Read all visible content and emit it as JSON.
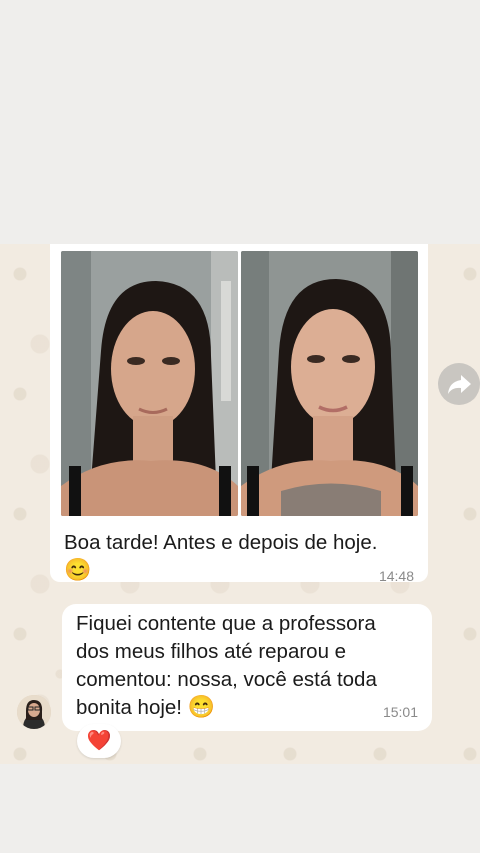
{
  "messages": [
    {
      "type": "image-pair",
      "caption": "Boa tarde! Antes e depois de hoje.",
      "caption_emoji": "😊",
      "time": "14:48",
      "photos": [
        "before-photo",
        "after-photo"
      ]
    },
    {
      "type": "text",
      "text": "Fiquei contente que a professora dos meus filhos até reparou e comentou: nossa, você está toda bonita hoje!",
      "text_emoji": "😁",
      "time": "15:01",
      "reaction": "❤️"
    }
  ],
  "icons": {
    "forward": "forward-arrow-icon",
    "avatar": "contact-avatar"
  },
  "colors": {
    "chat_background": "#f2ebe1",
    "bubble": "#ffffff",
    "time_text": "#8a8a8a",
    "forward_button": "#c9c6c1"
  }
}
